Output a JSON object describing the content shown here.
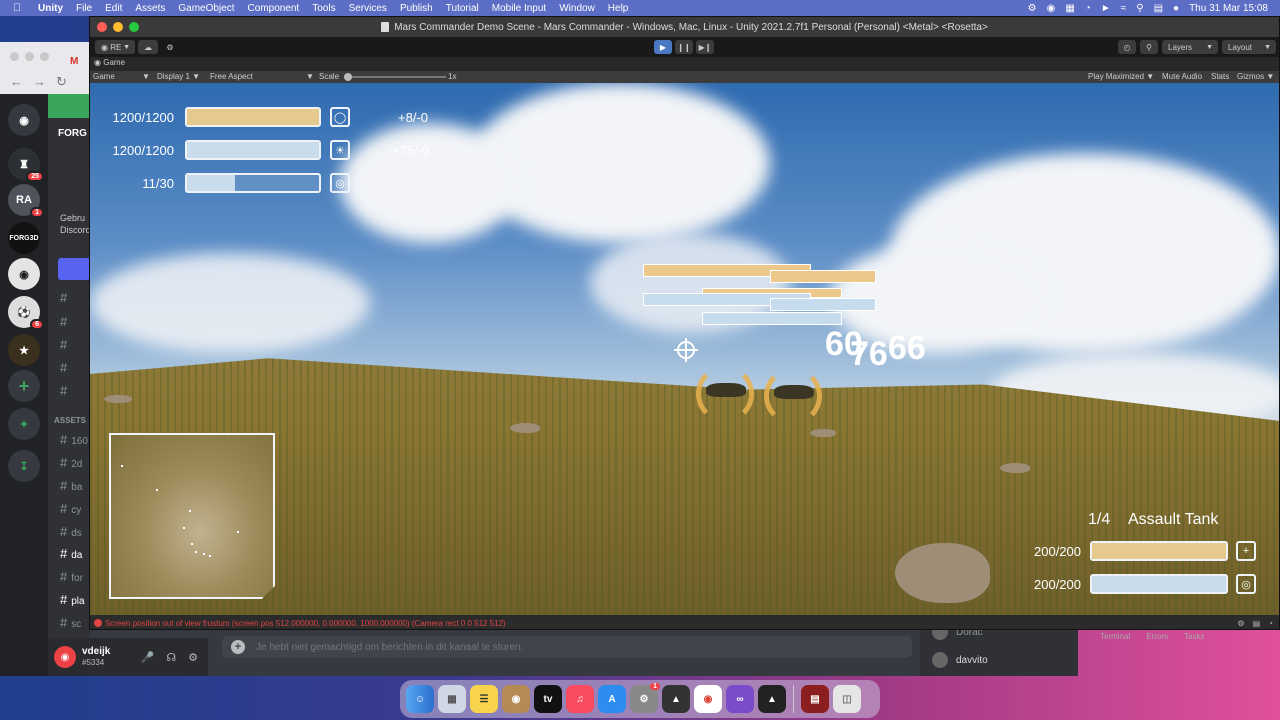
{
  "menubar": {
    "app": "Unity",
    "items": [
      "File",
      "Edit",
      "Assets",
      "GameObject",
      "Component",
      "Tools",
      "Services",
      "Publish",
      "Tutorial",
      "Mobile Input",
      "Window",
      "Help"
    ],
    "clock": "Thu 31 Mar  15:08"
  },
  "discord": {
    "server_header": "FORG",
    "welcome": "Gebru\nDiscord",
    "guild_labels": {
      "ra": "RA",
      "forged": "FORG3D"
    },
    "badges": {
      "g1": "25",
      "g2": "1",
      "g3": "6"
    },
    "category": "ASSETS",
    "channels": [
      "160",
      "2d",
      "ba",
      "cy",
      "ds",
      "da",
      "for",
      "pla",
      "sc"
    ],
    "user": {
      "name": "vdeijk",
      "tag": "#5334"
    },
    "chat_placeholder": "Je hebt niet gemachtigd om berichten in dit kanaal te sturen.",
    "members": [
      "Dorac",
      "davvito"
    ]
  },
  "unity": {
    "window_title": "Mars Commander Demo Scene - Mars Commander - Windows, Mac, Linux - Unity 2021.2.7f1 Personal (Personal) <Metal> <Rosetta>",
    "toolbar": {
      "account": "RE",
      "layers": "Layers",
      "layout": "Layout"
    },
    "tab_game": "Game",
    "gamebar": {
      "display_mode": "Game",
      "display": "Display 1",
      "aspect": "Free Aspect",
      "scale_label": "Scale",
      "scale_value": "1x",
      "play_maximized": "Play Maximized",
      "mute": "Mute Audio",
      "stats": "Stats",
      "gizmos": "Gizmos"
    },
    "console_message": "Screen position out of view frustum (screen pos 512.000000, 0.000000, 1000.000000) (Camera rect 0 0 512 512)",
    "bg_tabs": [
      "Terminal",
      "Errors",
      "Tasks"
    ]
  },
  "hud": {
    "stats": [
      {
        "value": "1200/1200",
        "delta": "+8/-0",
        "fill": 1.0,
        "color": "gold",
        "icon": "shield-icon"
      },
      {
        "value": "1200/1200",
        "delta": "+75/-0",
        "fill": 1.0,
        "color": "blue",
        "icon": "sun-icon"
      },
      {
        "value": "11/30",
        "delta": "",
        "fill": 0.367,
        "color": "blue",
        "icon": "target-icon"
      }
    ],
    "damage_numbers": [
      "60",
      "76",
      "66"
    ],
    "selected_unit": {
      "count": "1/4",
      "name": "Assault Tank",
      "health": "200/200",
      "health_fill": 1.0,
      "shield": "200/200",
      "shield_fill": 1.0
    }
  },
  "dock": {
    "apps": [
      "finder",
      "launchpad",
      "notes",
      "contacts",
      "tv",
      "music",
      "app-store",
      "settings",
      "unity-hub",
      "chrome",
      "visual-studio",
      "unity",
      "files",
      "trash"
    ],
    "tv_label": "tv",
    "settings_badge": "1"
  },
  "colors": {
    "accent_gold": "#e6c98c",
    "accent_blue": "#c9dcec",
    "play_blue": "#4a78c2",
    "discord_red": "#ed4245"
  }
}
